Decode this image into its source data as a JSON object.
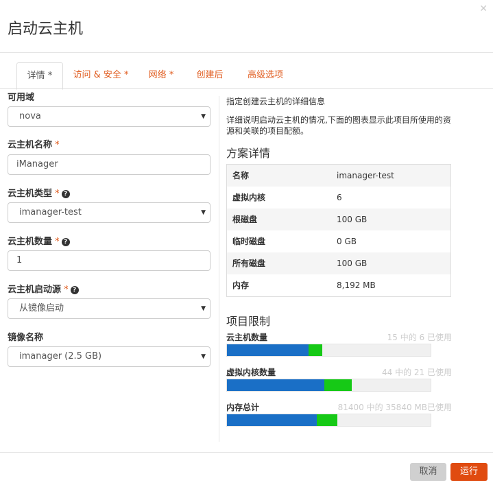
{
  "dialog": {
    "title": "启动云主机"
  },
  "tabs": [
    {
      "label": "详情",
      "star": " *"
    },
    {
      "label": "访问 & 安全",
      "star": " *"
    },
    {
      "label": "网络",
      "star": " *"
    },
    {
      "label": "创建后",
      "star": ""
    },
    {
      "label": "高级选项",
      "star": ""
    }
  ],
  "form": {
    "availability_zone": {
      "label": "可用域",
      "value": "nova"
    },
    "instance_name": {
      "label": "云主机名称",
      "required": " *",
      "value": "iManager"
    },
    "flavor": {
      "label": "云主机类型",
      "required": " *",
      "value": "imanager-test"
    },
    "count": {
      "label": "云主机数量",
      "required": " *",
      "value": "1"
    },
    "boot_source": {
      "label": "云主机启动源",
      "required": " *",
      "value": "从镜像启动"
    },
    "image_name": {
      "label": "镜像名称",
      "value": "imanager (2.5 GB)"
    }
  },
  "right": {
    "intro": "指定创建云主机的详细信息",
    "description": "详细说明启动云主机的情况,下面的图表显示此项目所使用的资源和关联的项目配额。",
    "flavor_details_title": "方案详情",
    "flavor_details": [
      {
        "key": "名称",
        "value": "imanager-test"
      },
      {
        "key": "虚拟内核",
        "value": "6"
      },
      {
        "key": "根磁盘",
        "value": "100 GB"
      },
      {
        "key": "临时磁盘",
        "value": "0 GB"
      },
      {
        "key": "所有磁盘",
        "value": "100 GB"
      },
      {
        "key": "内存",
        "value": "8,192 MB"
      }
    ],
    "limits_title": "项目限制",
    "limits": [
      {
        "label": "云主机数量",
        "used_text": "15 中的 6 已使用",
        "used_fraction": 0.4,
        "added_fraction": 0.0667
      },
      {
        "label": "虚拟内核数量",
        "used_text": "44 中的 21 已使用",
        "used_fraction": 0.4773,
        "added_fraction": 0.1364
      },
      {
        "label": "内存总计",
        "used_text": "81400 中的 35840 MB已使用",
        "used_fraction": 0.4403,
        "added_fraction": 0.1006
      }
    ]
  },
  "footer": {
    "cancel_label": "取消",
    "run_label": "运行"
  },
  "colors": {
    "accent": "#e04b10",
    "used_bar": "#1a6fc6",
    "added_bar": "#16c916"
  }
}
